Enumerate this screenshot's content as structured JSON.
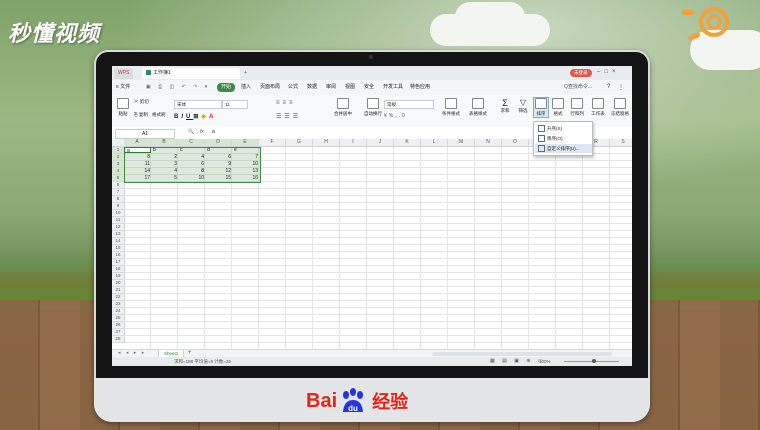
{
  "watermark_top": "秒懂视频",
  "brand_bottom": {
    "bai": "Bai",
    "du": "du",
    "cn": "经验"
  },
  "app": {
    "tabs": [
      {
        "label": "WPS"
      },
      {
        "label": "工作簿1"
      },
      {
        "label": "+"
      }
    ],
    "login_button": "未登录",
    "menu": [
      "≡ 文件",
      "开始",
      "插入",
      "页面布局",
      "公式",
      "数据",
      "审阅",
      "视图",
      "安全",
      "开发工具",
      "特色应用"
    ],
    "search": "Q查找命令...",
    "ribbon": {
      "paste": "粘贴",
      "cut": "剪切",
      "copy": "复制",
      "format_painter": "格式刷",
      "font": "宋体",
      "size": "11",
      "merge": "合并居中",
      "wrap": "自动换行",
      "number_format": "常规",
      "cond_format": "条件格式",
      "table_style": "表格样式",
      "sum": "求和",
      "filter": "筛选",
      "sort": "排序",
      "format": "格式",
      "row_col": "行和列",
      "worksheet": "工作表",
      "freeze": "冻结窗格"
    },
    "name_box": "A1",
    "formula_value": "a",
    "fx": "fx",
    "columns": [
      "A",
      "B",
      "C",
      "D",
      "E",
      "F",
      "G",
      "H",
      "I",
      "J",
      "K",
      "L",
      "M",
      "N",
      "O",
      "P",
      "Q",
      "R",
      "S"
    ],
    "rows": [
      "1",
      "2",
      "3",
      "4",
      "5",
      "6",
      "7",
      "8",
      "9",
      "10",
      "11",
      "12",
      "13",
      "14",
      "15",
      "16",
      "17",
      "18",
      "19",
      "20",
      "21",
      "22",
      "23",
      "24",
      "25",
      "26",
      "27",
      "28"
    ],
    "cells": [
      [
        "a",
        "b",
        "c",
        "d",
        "e"
      ],
      [
        "8",
        "2",
        "4",
        "6",
        "7"
      ],
      [
        "11",
        "3",
        "6",
        "9",
        "10"
      ],
      [
        "14",
        "4",
        "8",
        "12",
        "13"
      ],
      [
        "17",
        "5",
        "10",
        "15",
        "16"
      ]
    ],
    "sort_menu": [
      "升序(S)",
      "降序(O)",
      "自定义排序(U)..."
    ],
    "sheet_tab": "Sheet1",
    "status_text": "求和=188  平均值=9  计数=25",
    "zoom": "100%"
  }
}
